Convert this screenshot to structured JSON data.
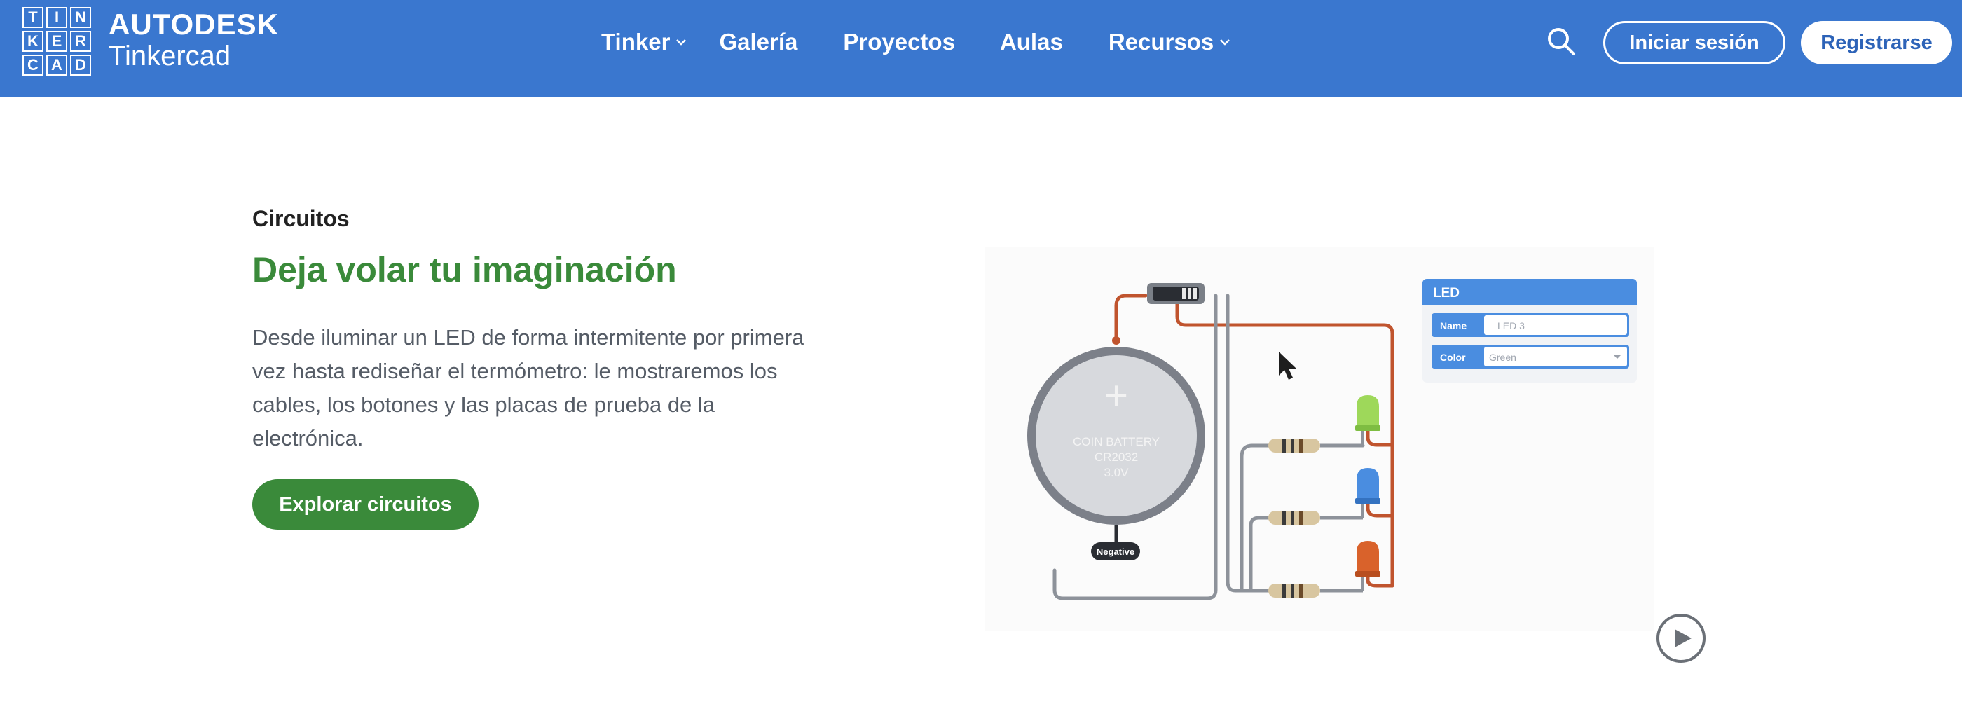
{
  "header": {
    "logo_letters": [
      "T",
      "I",
      "N",
      "K",
      "E",
      "R",
      "C",
      "A",
      "D"
    ],
    "brand_top": "AUTODESK",
    "brand_bottom": "Tinkercad",
    "nav": [
      {
        "label": "Tinker",
        "has_dropdown": true
      },
      {
        "label": "Galería",
        "has_dropdown": false
      },
      {
        "label": "Proyectos",
        "has_dropdown": false
      },
      {
        "label": "Aulas",
        "has_dropdown": false
      },
      {
        "label": "Recursos",
        "has_dropdown": true
      }
    ],
    "search_icon": "search-icon",
    "login_label": "Iniciar sesión",
    "register_label": "Registrarse"
  },
  "section": {
    "eyebrow": "Circuitos",
    "headline": "Deja volar tu imaginación",
    "description": "Desde iluminar un LED de forma intermitente por primera vez hasta rediseñar el termómetro: le mostraremos los cables, los botones y las placas de prueba de la electrónica.",
    "cta_label": "Explorar circuitos"
  },
  "illustration": {
    "battery_symbol": "+",
    "battery_line1": "COIN BATTERY",
    "battery_line2": "CR2032",
    "battery_line3": "3.0V",
    "negative_label": "Negative",
    "panel_title": "LED",
    "name_label": "Name",
    "name_value": "LED 3",
    "color_label": "Color",
    "color_value": "Green"
  },
  "colors": {
    "header_bg": "#3a77cf",
    "accent_green": "#3a8a3a",
    "led_green": "#9ed85a",
    "led_blue": "#4a8de0",
    "led_orange": "#d9622b",
    "wire_red": "#c0542e",
    "wire_gray": "#8d929a"
  }
}
